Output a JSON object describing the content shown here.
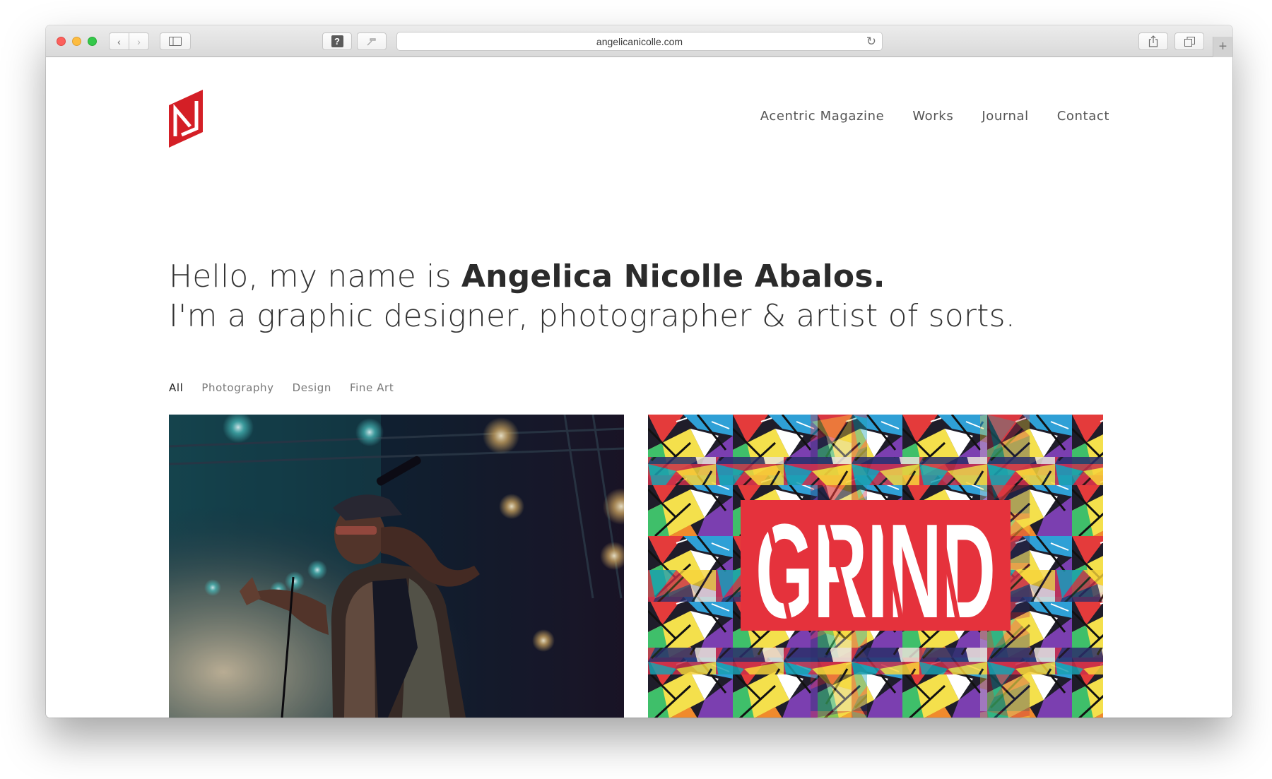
{
  "browser": {
    "url": "angelicanicolle.com",
    "icons": {
      "back": "chevron-left-icon",
      "forward": "chevron-right-icon",
      "sidebar": "sidebar-icon",
      "help": "question-icon",
      "pin": "pin-icon",
      "reload": "reload-icon",
      "share": "share-icon",
      "tabs": "tabs-icon",
      "new_tab": "plus-icon"
    }
  },
  "site": {
    "logo_icon": "an-monogram-logo",
    "brand_color": "#d41f26",
    "nav": [
      {
        "label": "Acentric Magazine"
      },
      {
        "label": "Works"
      },
      {
        "label": "Journal"
      },
      {
        "label": "Contact"
      }
    ],
    "hero": {
      "greeting": "Hello, my name is ",
      "name": "Angelica Nicolle Abalos.",
      "tagline": "I'm a graphic designer, photographer & artist of sorts."
    },
    "filters": [
      {
        "label": "All",
        "active": true
      },
      {
        "label": "Photography",
        "active": false
      },
      {
        "label": "Design",
        "active": false
      },
      {
        "label": "Fine Art",
        "active": false
      }
    ],
    "portfolio": [
      {
        "kind": "concert-photo"
      },
      {
        "kind": "graffiti-collage",
        "overlay_text": "GRIND"
      }
    ]
  }
}
